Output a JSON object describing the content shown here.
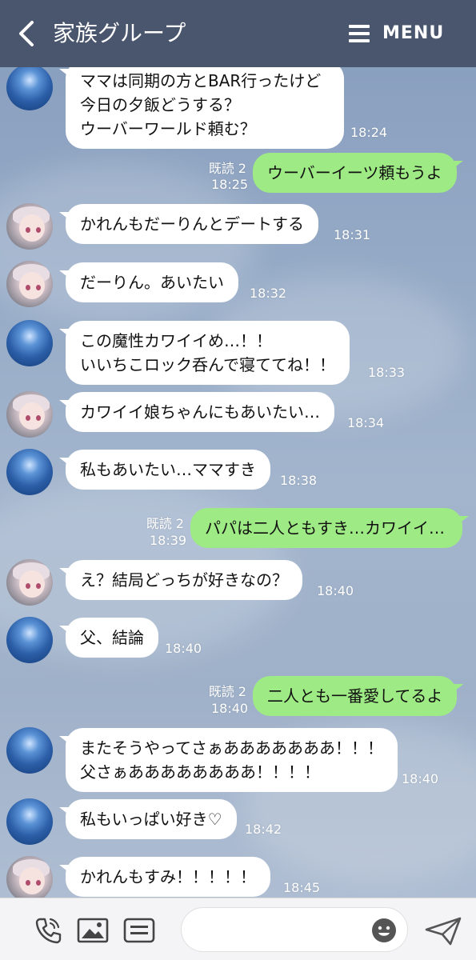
{
  "header": {
    "title": "家族グループ",
    "menu_label": "MENU"
  },
  "messages": [
    {
      "side": "in",
      "avatar": "earth-avatar",
      "lines": [
        "ママは同期の方とBAR行ったけど",
        "今日の夕飯どうする？",
        "ウーバーワールド頼む？"
      ],
      "time": "18:24"
    },
    {
      "side": "out",
      "read": "既読 2",
      "lines": [
        "ウーバーイーツ頼もうよ"
      ],
      "time": "18:25"
    },
    {
      "side": "in",
      "avatar": "girl-avatar",
      "lines": [
        "かれんもだーりんとデートする"
      ],
      "time": "18:31"
    },
    {
      "side": "in",
      "avatar": "girl-avatar",
      "lines": [
        "だーりん。あいたい"
      ],
      "time": "18:32"
    },
    {
      "side": "in",
      "avatar": "earth-avatar",
      "lines": [
        "この魔性カワイイめ…！！",
        "いいちこロック呑んで寝ててね！！"
      ],
      "time": "18:33"
    },
    {
      "side": "in",
      "avatar": "girl-avatar",
      "lines": [
        "カワイイ娘ちゃんにもあいたい…"
      ],
      "time": "18:34"
    },
    {
      "side": "in",
      "avatar": "earth-avatar",
      "lines": [
        "私もあいたい…ママすき"
      ],
      "time": "18:38"
    },
    {
      "side": "out",
      "read": "既読 2",
      "lines": [
        "パパは二人ともすき…カワイイ…"
      ],
      "time": "18:39"
    },
    {
      "side": "in",
      "avatar": "girl-avatar",
      "lines": [
        "え？結局どっちが好きなの？"
      ],
      "time": "18:40"
    },
    {
      "side": "in",
      "avatar": "earth-avatar",
      "lines": [
        "父、結論"
      ],
      "time": "18:40"
    },
    {
      "side": "out",
      "read": "既読 2",
      "lines": [
        "二人とも一番愛してるよ"
      ],
      "time": "18:40"
    },
    {
      "side": "in",
      "avatar": "earth-avatar",
      "lines": [
        "またそうやってさぁあああああああ！！！",
        "父さぁああああああああ！！！！"
      ],
      "time": "18:40"
    },
    {
      "side": "in",
      "avatar": "earth-avatar",
      "lines": [
        "私もいっぱい好き♡"
      ],
      "time": "18:42"
    },
    {
      "side": "in",
      "avatar": "girl-avatar",
      "lines": [
        "かれんもすみ！！！！！"
      ],
      "time": "18:45"
    }
  ],
  "footer": {
    "icons": [
      "phone-icon",
      "image-icon",
      "keyboard-icon",
      "emoji-icon",
      "send-icon"
    ]
  },
  "colors": {
    "header_bg": "#4a566e",
    "outgoing_bubble": "#9eea84",
    "incoming_bubble": "#ffffff"
  }
}
